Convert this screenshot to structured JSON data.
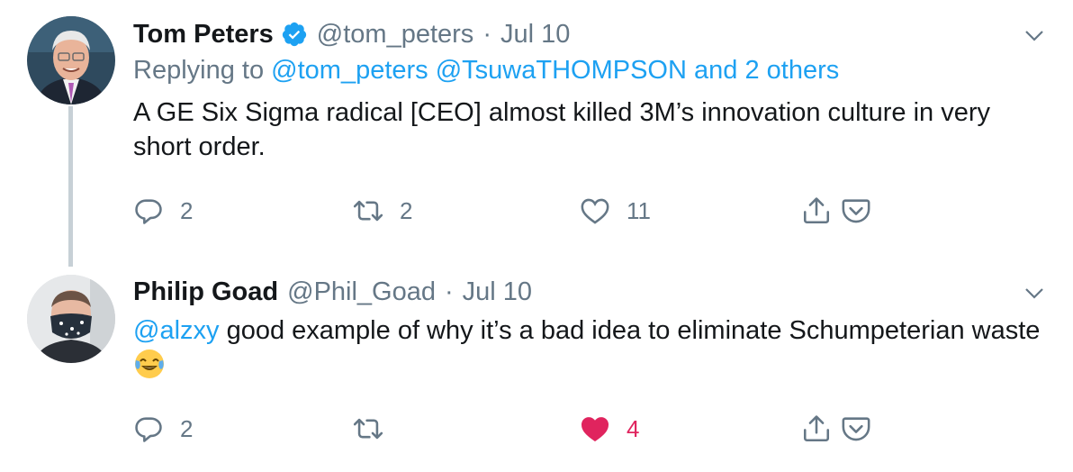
{
  "tweets": [
    {
      "author": "Tom Peters",
      "handle": "@tom_peters",
      "separator": "·",
      "date": "Jul 10",
      "replying_prefix": "Replying to",
      "replying_users": [
        "@tom_peters",
        "@TsuwaTHOMPSON"
      ],
      "replying_suffix": "and 2 others",
      "text": "A GE Six Sigma radical [CEO] almost killed 3M’s innovation culture in very short order.",
      "replies": "2",
      "retweets": "2",
      "likes": "11"
    },
    {
      "author": "Philip Goad",
      "handle": "@Phil_Goad",
      "separator": "·",
      "date": "Jul 10",
      "mention": "@alzxy",
      "text_line": " good example of why it’s a bad idea to eliminate Schumpeterian waste ",
      "replies": "2",
      "retweets": "",
      "likes": "4"
    }
  ],
  "colors": {
    "link": "#1da1f2",
    "muted": "#657786",
    "liked": "#e0245e",
    "thread_line": "#c7d0d6"
  }
}
